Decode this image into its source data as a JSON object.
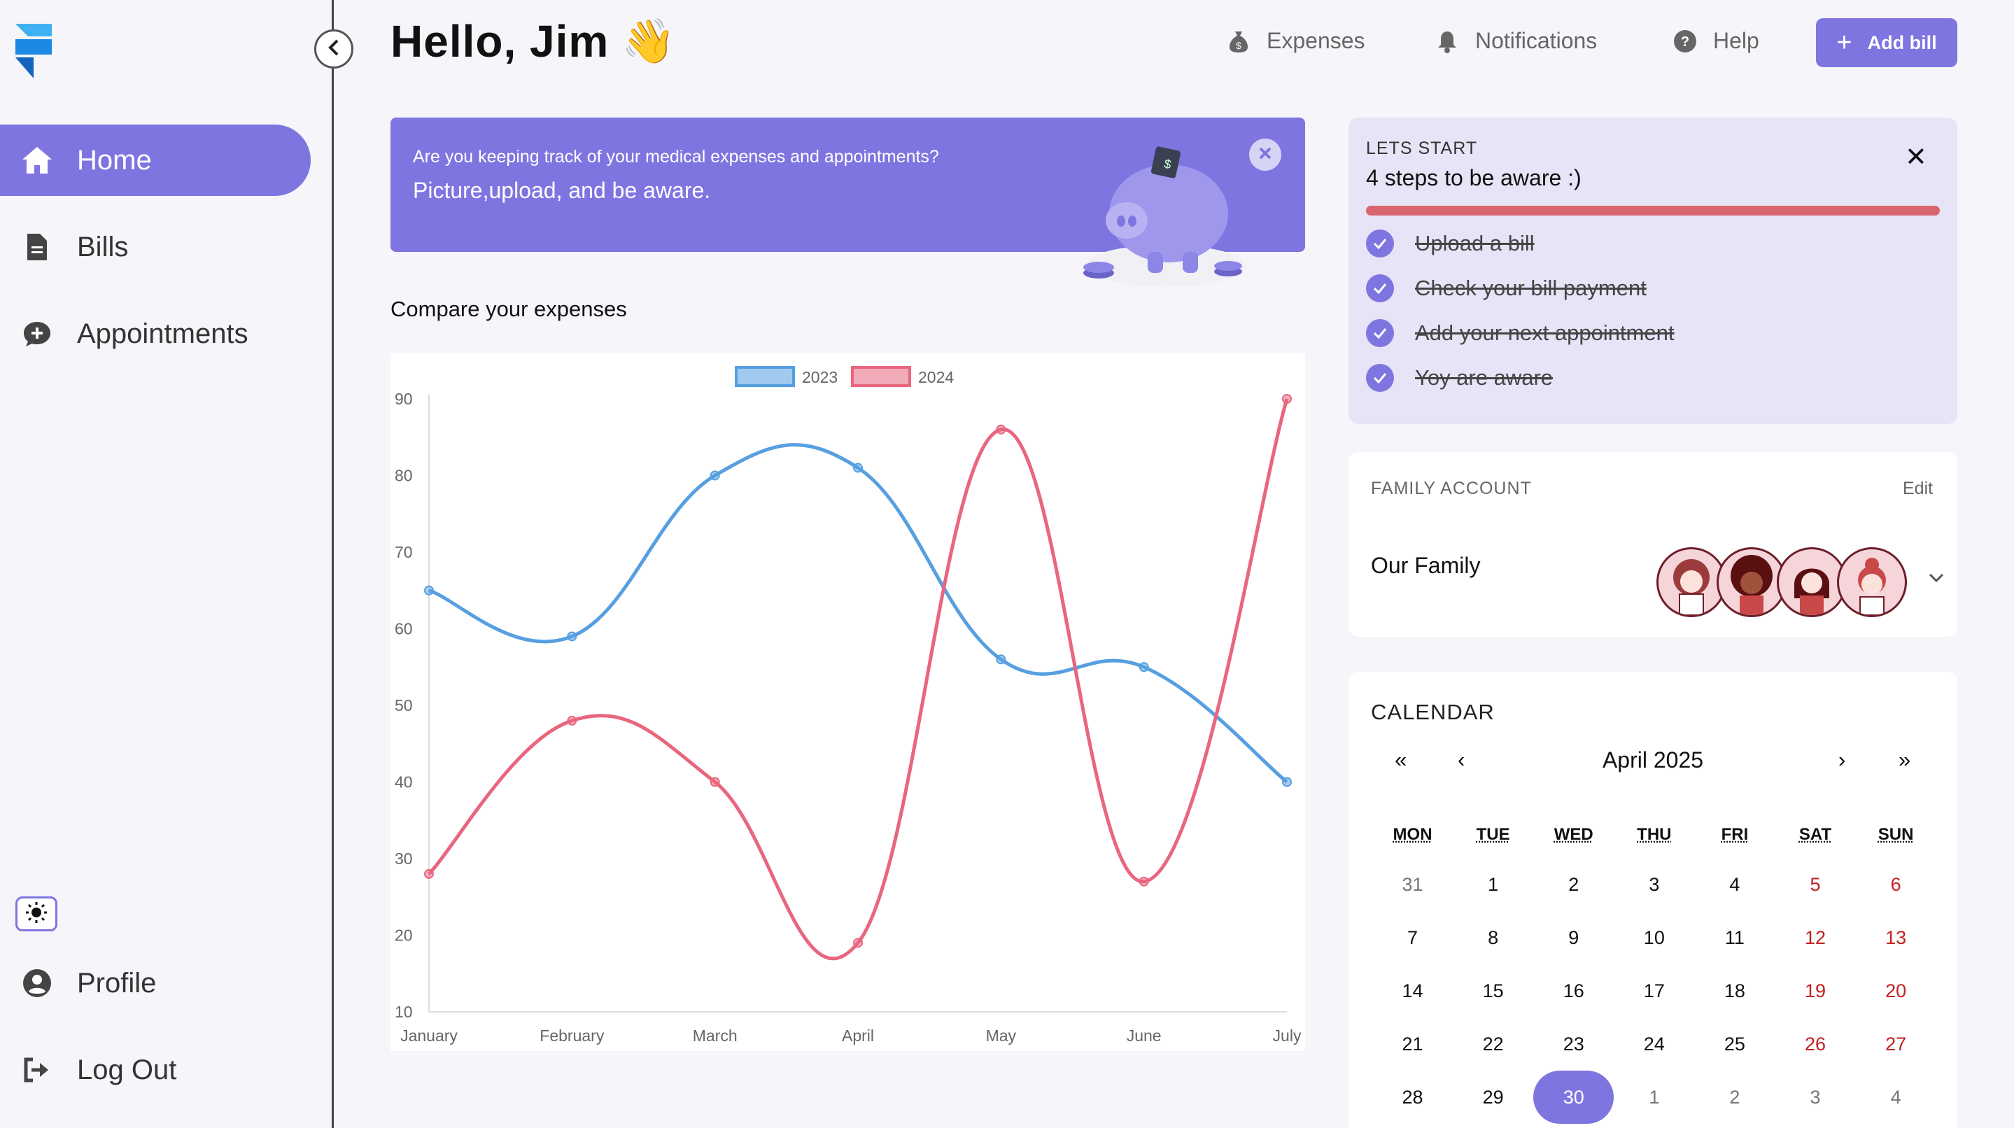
{
  "sidebar": {
    "items": [
      {
        "label": "Home",
        "icon": "home-icon",
        "active": true
      },
      {
        "label": "Bills",
        "icon": "document-icon"
      },
      {
        "label": "Appointments",
        "icon": "chat-plus-icon"
      }
    ],
    "bottom_items": [
      {
        "label": "Profile",
        "icon": "user-circle-icon"
      },
      {
        "label": "Log Out",
        "icon": "logout-icon"
      }
    ],
    "theme_icon": "sun-icon"
  },
  "header": {
    "greeting": "Hello, Jim",
    "wave_emoji": "👋",
    "links": [
      {
        "label": "Expenses",
        "icon": "money-bag-icon"
      },
      {
        "label": "Notifications",
        "icon": "bell-icon"
      },
      {
        "label": "Help",
        "icon": "question-icon"
      }
    ],
    "add_bill_label": "Add bill"
  },
  "banner": {
    "question": "Are you keeping track of your medical expenses and appointments?",
    "subtitle": "Picture,upload, and be aware."
  },
  "chart_section": {
    "title": "Compare your expenses"
  },
  "chart_data": {
    "type": "line",
    "categories": [
      "January",
      "February",
      "March",
      "April",
      "May",
      "June",
      "July"
    ],
    "series": [
      {
        "name": "2023",
        "values": [
          65,
          59,
          80,
          81,
          56,
          55,
          40
        ],
        "color": "#569fe0"
      },
      {
        "name": "2024",
        "values": [
          28,
          48,
          40,
          19,
          86,
          27,
          90
        ],
        "color": "#e8667e"
      }
    ],
    "ylim": [
      10,
      90
    ],
    "yticks": [
      10,
      20,
      30,
      40,
      50,
      60,
      70,
      80,
      90
    ],
    "legend": "top-center",
    "grid": false
  },
  "steps": {
    "label": "LETS START",
    "title": "4 steps to be aware :)",
    "progress": 1.0,
    "items": [
      "Upload a bill",
      "Check your bill payment",
      "Add your next appointment",
      "Yoy are aware"
    ]
  },
  "family": {
    "label": "FAMILY ACCOUNT",
    "edit_label": "Edit",
    "name": "Our Family",
    "member_count": 4
  },
  "calendar": {
    "label": "CALENDAR",
    "month": "April 2025",
    "nav": {
      "prev_year": "«",
      "prev_month": "‹",
      "next_month": "›",
      "next_year": "»"
    },
    "weekdays": [
      "MON",
      "TUE",
      "WED",
      "THU",
      "FRI",
      "SAT",
      "SUN"
    ],
    "weeks": [
      [
        "31",
        "1",
        "2",
        "3",
        "4",
        "5",
        "6"
      ],
      [
        "7",
        "8",
        "9",
        "10",
        "11",
        "12",
        "13"
      ],
      [
        "14",
        "15",
        "16",
        "17",
        "18",
        "19",
        "20"
      ],
      [
        "21",
        "22",
        "23",
        "24",
        "25",
        "26",
        "27"
      ],
      [
        "28",
        "29",
        "30",
        "1",
        "2",
        "3",
        "4"
      ]
    ],
    "selected": "30",
    "accent": "#7f75e0",
    "weekend_color": "#c41f1f"
  }
}
